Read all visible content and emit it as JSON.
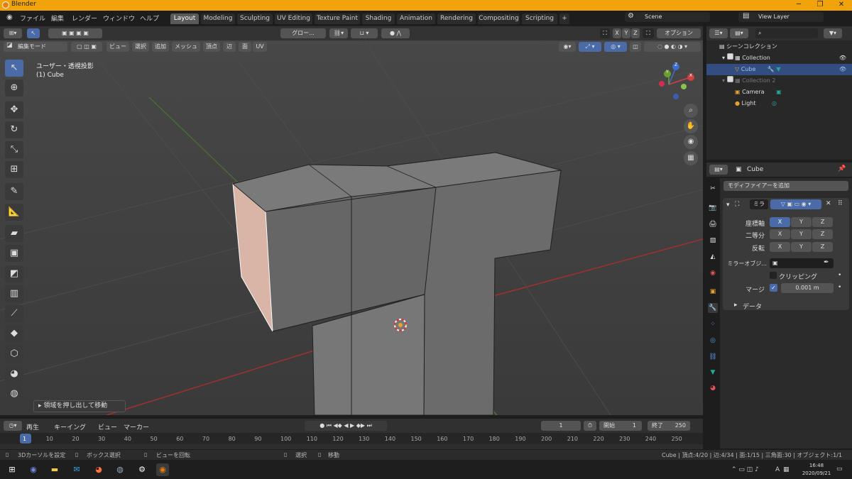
{
  "window": {
    "title": "Blender",
    "controls": [
      "─",
      "❐",
      "✕"
    ]
  },
  "menu": [
    "ファイル",
    "編集",
    "レンダー",
    "ウィンドウ",
    "ヘルプ"
  ],
  "workspaces": [
    "Layout",
    "Modeling",
    "Sculpting",
    "UV Editing",
    "Texture Paint",
    "Shading",
    "Animation",
    "Rendering",
    "Compositing",
    "Scripting",
    "+"
  ],
  "active_workspace": "Layout",
  "scene": {
    "name": "Scene",
    "view_layer": "View Layer"
  },
  "viewport": {
    "header1": {
      "transform": "グロー...",
      "xyz": [
        "X",
        "Y",
        "Z"
      ],
      "options": "オプション"
    },
    "mode": "編集モード",
    "menus": [
      "ビュー",
      "選択",
      "追加",
      "メッシュ",
      "頂点",
      "辺",
      "面",
      "UV"
    ],
    "overlay_title": "ユーザー・透視投影",
    "overlay_object": "(1) Cube",
    "gizmo": {
      "x": "X",
      "y": "Y",
      "z": "Z"
    },
    "operator_panel": "領域を押し出して移動"
  },
  "outliner": {
    "root": "シーンコレクション",
    "items": [
      {
        "name": "Collection",
        "level": 1
      },
      {
        "name": "Cube",
        "level": 2
      },
      {
        "name": "Collection 2",
        "level": 1
      },
      {
        "name": "Camera",
        "level": 2
      },
      {
        "name": "Light",
        "level": 2
      }
    ]
  },
  "properties": {
    "object": "Cube",
    "add_modifier": "モディファイアーを追加",
    "modifier_name": "ミラ",
    "rows": [
      {
        "label": "座標軸",
        "values": [
          "X",
          "Y",
          "Z"
        ]
      },
      {
        "label": "二等分",
        "values": [
          "X",
          "Y",
          "Z"
        ]
      },
      {
        "label": "反転",
        "values": [
          "X",
          "Y",
          "Z"
        ]
      }
    ],
    "mirror_object_label": "ミラーオブジ...",
    "clipping": "クリッピング",
    "merge_label": "マージ",
    "merge_value": "0.001 m",
    "data": "データ"
  },
  "timeline": {
    "menus": [
      "再生",
      "キーイング",
      "ビュー",
      "マーカー"
    ],
    "current_frame": "1",
    "start_label": "開始",
    "start": "1",
    "end_label": "終了",
    "end": "250",
    "ticks": [
      "1",
      "10",
      "20",
      "30",
      "40",
      "50",
      "60",
      "70",
      "80",
      "90",
      "100",
      "110",
      "120",
      "130",
      "140",
      "150",
      "160",
      "170",
      "180",
      "190",
      "200",
      "210",
      "220",
      "230",
      "240",
      "250"
    ]
  },
  "status": {
    "left": [
      "3Dカーソルを設定",
      "ボックス選択",
      "ビューを回転",
      "選択",
      "移動"
    ],
    "right": "Cube | 頂点:4/20 | 辺:4/34 | 面:1/15 | 三角面:30 | オブジェクト:1/1"
  },
  "taskbar": {
    "time": "16:48",
    "date": "2020/09/21",
    "lang": "A"
  }
}
